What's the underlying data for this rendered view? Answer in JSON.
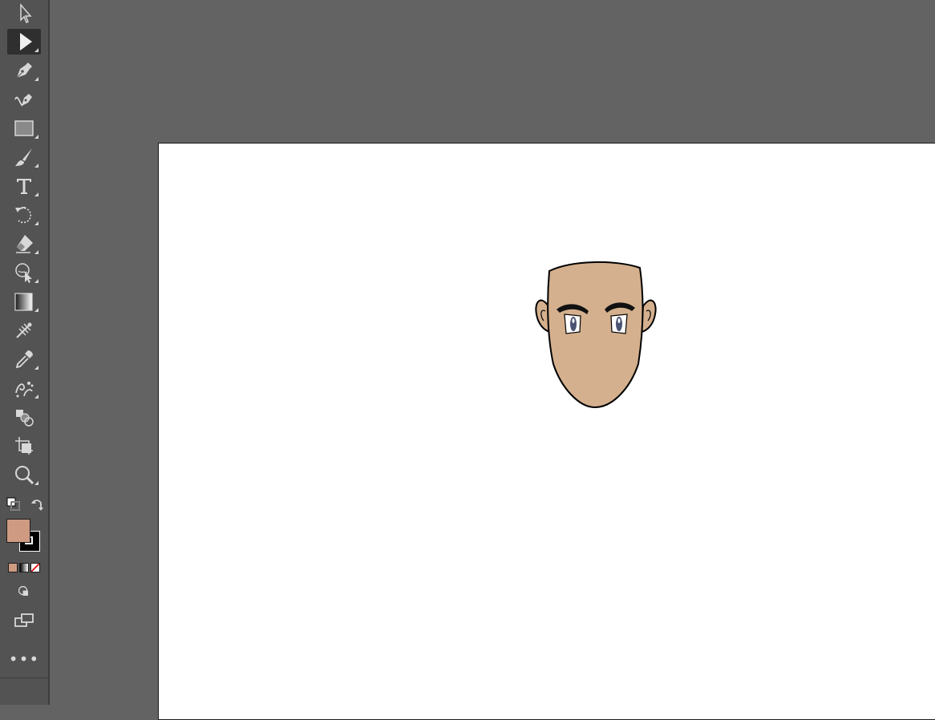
{
  "colors": {
    "workspace": "#636363",
    "toolbar": "#535353",
    "toolbar_active": "#2f2f2f",
    "fill_color": "#cf9a82",
    "stroke_color": "#000000",
    "skin": "#d4b08e",
    "eye_iris": "#4a5372"
  },
  "toolbar": {
    "tools": [
      {
        "name": "selection-tool",
        "icon": "arrow-outline-icon",
        "active": false
      },
      {
        "name": "direct-selection-tool",
        "icon": "arrow-solid-icon",
        "active": true
      },
      {
        "name": "pen-tool",
        "icon": "pen-icon",
        "active": false
      },
      {
        "name": "curvature-tool",
        "icon": "curvature-pen-icon",
        "active": false
      },
      {
        "name": "rectangle-tool",
        "icon": "rectangle-icon",
        "active": false
      },
      {
        "name": "paintbrush-tool",
        "icon": "brush-icon",
        "active": false
      },
      {
        "name": "type-tool",
        "icon": "type-icon",
        "active": false
      },
      {
        "name": "rotate-tool",
        "icon": "rotate-icon",
        "active": false
      },
      {
        "name": "eraser-tool",
        "icon": "eraser-icon",
        "active": false
      },
      {
        "name": "shape-builder-tool",
        "icon": "shape-builder-icon",
        "active": false
      },
      {
        "name": "gradient-tool",
        "icon": "gradient-icon",
        "active": false
      },
      {
        "name": "mesh-tool",
        "icon": "mesh-icon",
        "active": false
      },
      {
        "name": "eyedropper-tool",
        "icon": "eyedropper-icon",
        "active": false
      },
      {
        "name": "symbol-sprayer-tool",
        "icon": "symbol-sprayer-icon",
        "active": false
      },
      {
        "name": "blend-tool",
        "icon": "blend-icon",
        "active": false
      },
      {
        "name": "artboard-tool",
        "icon": "artboard-icon",
        "active": false
      },
      {
        "name": "zoom-tool",
        "icon": "zoom-icon",
        "active": false
      }
    ],
    "more_label": "•••"
  }
}
